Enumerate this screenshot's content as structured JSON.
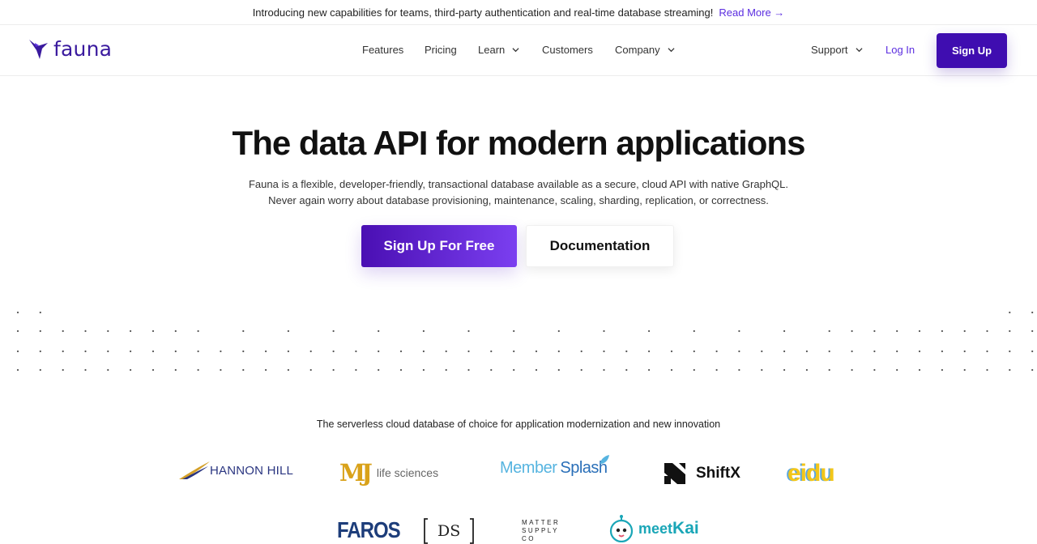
{
  "announcement": {
    "text": "Introducing new capabilities for teams, third-party authentication and real-time database streaming!",
    "link_label": "Read More →"
  },
  "header": {
    "logo_text": "fauna",
    "nav": [
      {
        "label": "Features",
        "has_dropdown": false
      },
      {
        "label": "Pricing",
        "has_dropdown": false
      },
      {
        "label": "Learn",
        "has_dropdown": true
      },
      {
        "label": "Customers",
        "has_dropdown": false
      },
      {
        "label": "Company",
        "has_dropdown": true
      }
    ],
    "support_label": "Support",
    "login_label": "Log In",
    "signup_label": "Sign Up"
  },
  "hero": {
    "title_pre": "The ",
    "title_bold": "data API",
    "title_post": " for modern applications",
    "subtitle_line1": "Fauna is a flexible, developer-friendly, transactional database available as a secure, cloud API with native GraphQL.",
    "subtitle_line2": "Never again worry about database provisioning, maintenance, scaling, sharding, replication, or correctness.",
    "primary_cta": "Sign Up For Free",
    "secondary_cta": "Documentation"
  },
  "customers": {
    "tagline": "The serverless cloud database of choice for application modernization and new innovation",
    "logos": [
      {
        "name": "HANNON HILL"
      },
      {
        "mark": "MJ",
        "name": "life sciences"
      },
      {
        "name_a": "Member",
        "name_b": "Splash"
      },
      {
        "name": "ShiftX"
      },
      {
        "name": "eidu"
      },
      {
        "name": "FAROS"
      },
      {
        "name": "DS"
      },
      {
        "line1": "MATTER",
        "line2": "SUPPLY",
        "line3": "CO"
      },
      {
        "name_a": "meet",
        "name_b": "Kai"
      }
    ]
  },
  "colors": {
    "brand": "#3f0db0",
    "accent": "#5b2de0"
  }
}
